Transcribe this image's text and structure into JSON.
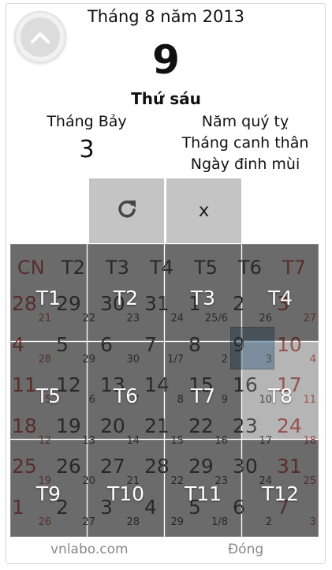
{
  "header": {
    "title": "Tháng 8 năm 2013",
    "day": "9",
    "weekday": "Thứ sáu",
    "lunar_month": "Tháng Bảy",
    "lunar_day": "3",
    "year_name": "Năm quý tỵ",
    "month_name": "Tháng canh thân",
    "day_name": "Ngày đinh mùi"
  },
  "actions": {
    "refresh_icon": "refresh-icon",
    "close_label": "x"
  },
  "weekdays": [
    "CN",
    "T2",
    "T3",
    "T4",
    "T5",
    "T6",
    "T7"
  ],
  "weeks": [
    [
      [
        "28",
        "21"
      ],
      [
        "29",
        "22"
      ],
      [
        "30",
        "23"
      ],
      [
        "31",
        "24"
      ],
      [
        "1",
        "25/6"
      ],
      [
        "2",
        "26"
      ],
      [
        "3",
        "27"
      ]
    ],
    [
      [
        "4",
        "28"
      ],
      [
        "5",
        "29"
      ],
      [
        "6",
        "30"
      ],
      [
        "7",
        "1/7"
      ],
      [
        "8",
        "2"
      ],
      [
        "9",
        "3"
      ],
      [
        "10",
        "4"
      ]
    ],
    [
      [
        "11",
        "5"
      ],
      [
        "12",
        "6"
      ],
      [
        "13",
        "7"
      ],
      [
        "14",
        "8"
      ],
      [
        "15",
        "9"
      ],
      [
        "16",
        "10"
      ],
      [
        "17",
        "11"
      ]
    ],
    [
      [
        "18",
        "12"
      ],
      [
        "19",
        "13"
      ],
      [
        "20",
        "14"
      ],
      [
        "21",
        "15"
      ],
      [
        "22",
        "16"
      ],
      [
        "23",
        "17"
      ],
      [
        "24",
        "18"
      ]
    ],
    [
      [
        "25",
        "19"
      ],
      [
        "26",
        "20"
      ],
      [
        "27",
        "21"
      ],
      [
        "28",
        "22"
      ],
      [
        "29",
        "23"
      ],
      [
        "30",
        "24"
      ],
      [
        "31",
        "25"
      ]
    ],
    [
      [
        "1",
        "26"
      ],
      [
        "2",
        "27"
      ],
      [
        "3",
        "28"
      ],
      [
        "4",
        "29"
      ],
      [
        "5",
        "1/8"
      ],
      [
        "6",
        "2"
      ],
      [
        "7",
        "3"
      ]
    ]
  ],
  "month_picker": [
    "T1",
    "T2",
    "T3",
    "T4",
    "T5",
    "T6",
    "T7",
    "T8",
    "T9",
    "T10",
    "T11",
    "T12"
  ],
  "footer": {
    "left": "vnlabo.com",
    "right": "Đóng"
  },
  "colors": {
    "sunday": "#b3261e",
    "saturday": "#b3261e",
    "overlay": "#3c3c3c",
    "selected_overlay": "#8a8a8a",
    "highlight": "#7fa7c7"
  }
}
